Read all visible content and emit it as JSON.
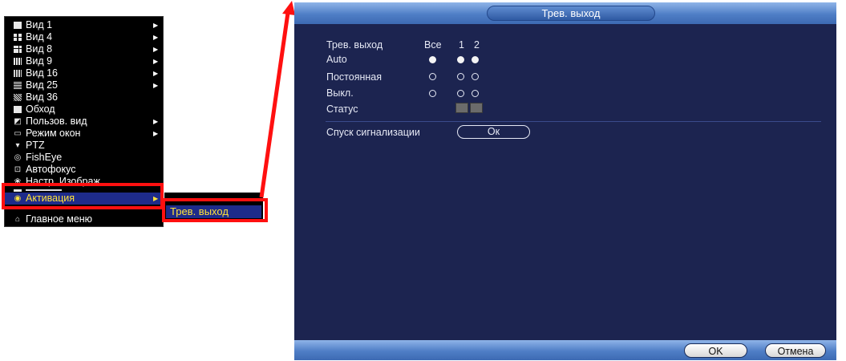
{
  "menu": {
    "items": [
      {
        "label": "Вид 1",
        "icon": "grid-1-icon",
        "has_submenu": true
      },
      {
        "label": "Вид 4",
        "icon": "grid-4-icon",
        "has_submenu": true
      },
      {
        "label": "Вид 8",
        "icon": "grid-8-icon",
        "has_submenu": true
      },
      {
        "label": "Вид 9",
        "icon": "grid-9-icon",
        "has_submenu": true
      },
      {
        "label": "Вид 16",
        "icon": "grid-16-icon",
        "has_submenu": true
      },
      {
        "label": "Вид 25",
        "icon": "grid-25-icon",
        "has_submenu": true
      },
      {
        "label": "Вид 36",
        "icon": "grid-36-icon",
        "has_submenu": false
      },
      {
        "label": "Обход",
        "icon": "tour-icon",
        "has_submenu": false
      },
      {
        "label": "Пользов. вид",
        "icon": "custom-view-icon",
        "has_submenu": true
      },
      {
        "label": "Режим окон",
        "icon": "window-mode-icon",
        "has_submenu": true
      },
      {
        "label": "PTZ",
        "icon": "ptz-icon",
        "has_submenu": false
      },
      {
        "label": "FishEye",
        "icon": "fisheye-icon",
        "has_submenu": false
      },
      {
        "label": "Автофокус",
        "icon": "autofocus-icon",
        "has_submenu": false
      },
      {
        "label": "Настр. Изображ.",
        "icon": "image-settings-icon",
        "has_submenu": false
      }
    ],
    "active_item": {
      "label": "Активация",
      "icon": "activation-icon"
    },
    "last_item": {
      "label": "Главное меню",
      "icon": "home-icon"
    },
    "submenu_selected": "Трев. выход"
  },
  "dialog": {
    "title": "Трев. выход",
    "header": {
      "label": "Трев. выход",
      "all": "Все",
      "ch1": "1",
      "ch2": "2"
    },
    "rows": [
      {
        "label": "Auto",
        "all": true,
        "ch1": true,
        "ch2": true
      },
      {
        "label": "Постоянная",
        "all": false,
        "ch1": false,
        "ch2": false
      },
      {
        "label": "Выкл.",
        "all": false,
        "ch1": false,
        "ch2": false
      }
    ],
    "status_label": "Статус",
    "trigger_label": "Спуск сигнализации",
    "trigger_button": "Ок",
    "ok_button": "OK",
    "cancel_button": "Отмена"
  },
  "colors": {
    "highlight_box": "#ff1010",
    "menu_selected_text": "#ffe23a",
    "dialog_bg": "#1c2450"
  }
}
